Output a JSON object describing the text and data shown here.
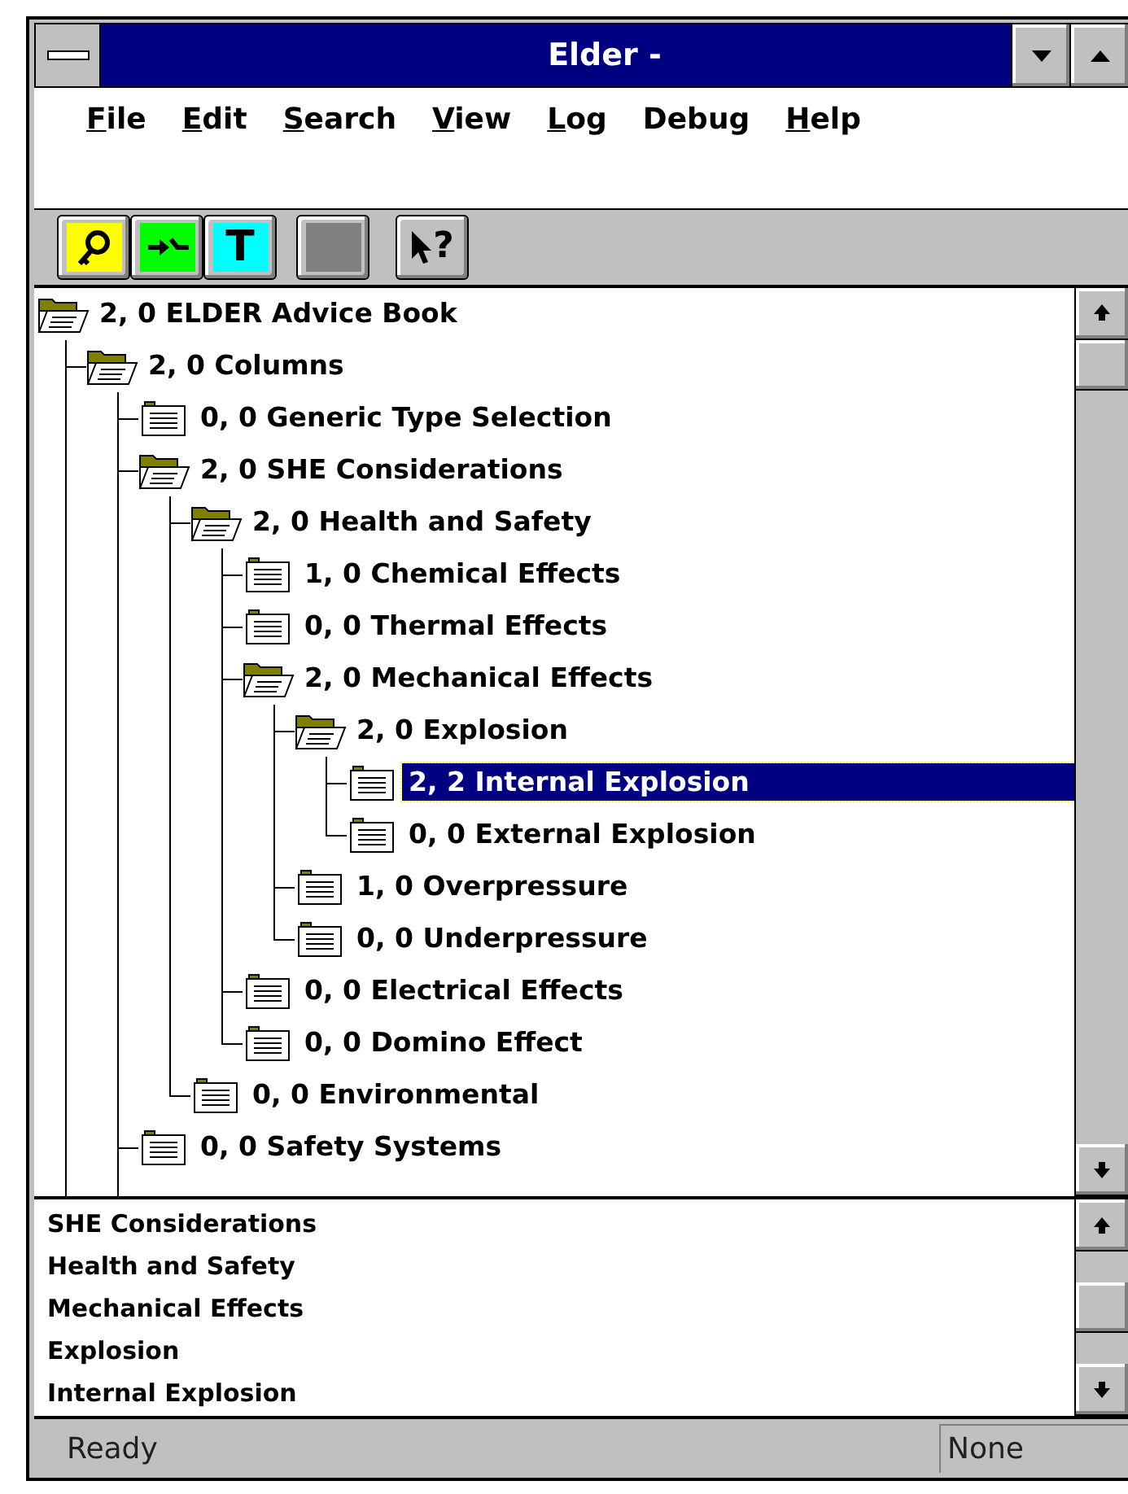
{
  "window": {
    "title": "Elder -"
  },
  "menu": [
    {
      "mnemonic": "F",
      "rest": "ile"
    },
    {
      "mnemonic": "E",
      "rest": "dit"
    },
    {
      "mnemonic": "S",
      "rest": "earch"
    },
    {
      "mnemonic": "V",
      "rest": "iew"
    },
    {
      "mnemonic": "L",
      "rest": "og"
    },
    {
      "rest": "Debug"
    },
    {
      "mnemonic": "H",
      "rest": "elp"
    }
  ],
  "toolbar": [
    {
      "kind": "key",
      "color": "#ffff00"
    },
    {
      "kind": "plug",
      "color": "#00ff00"
    },
    {
      "kind": "text",
      "color": "#00ffff",
      "label": "T"
    },
    {
      "kind": "blank",
      "color": "#808080"
    },
    {
      "kind": "help",
      "color": "#c0c0c0",
      "label": "?"
    }
  ],
  "tree": [
    {
      "label": "2, 0 ELDER Advice Book",
      "kind": "folder",
      "selected": false,
      "children": [
        {
          "label": "2, 0 Columns",
          "kind": "folder",
          "selected": false,
          "has_more": true,
          "children": [
            {
              "label": "0, 0 Generic Type Selection",
              "kind": "document",
              "selected": false
            },
            {
              "label": "2, 0 SHE Considerations",
              "kind": "folder",
              "selected": false,
              "children": [
                {
                  "label": "2, 0 Health and Safety",
                  "kind": "folder",
                  "selected": false,
                  "children": [
                    {
                      "label": "1, 0 Chemical Effects",
                      "kind": "document",
                      "selected": false
                    },
                    {
                      "label": "0, 0 Thermal Effects",
                      "kind": "document",
                      "selected": false
                    },
                    {
                      "label": "2, 0 Mechanical Effects",
                      "kind": "folder",
                      "selected": false,
                      "children": [
                        {
                          "label": "2, 0 Explosion",
                          "kind": "folder",
                          "selected": false,
                          "children": [
                            {
                              "label": "2, 2 Internal Explosion",
                              "kind": "document",
                              "selected": true
                            },
                            {
                              "label": "0, 0 External Explosion",
                              "kind": "document",
                              "selected": false
                            }
                          ]
                        },
                        {
                          "label": "1, 0 Overpressure",
                          "kind": "document",
                          "selected": false
                        },
                        {
                          "label": "0, 0 Underpressure",
                          "kind": "document",
                          "selected": false
                        }
                      ]
                    },
                    {
                      "label": "0, 0 Electrical Effects",
                      "kind": "document",
                      "selected": false
                    },
                    {
                      "label": "0, 0 Domino Effect",
                      "kind": "document",
                      "selected": false
                    }
                  ]
                },
                {
                  "label": "0, 0 Environmental",
                  "kind": "document",
                  "selected": false
                }
              ]
            },
            {
              "label": "0, 0 Safety Systems",
              "kind": "document",
              "selected": false,
              "has_more": true
            }
          ]
        }
      ]
    }
  ],
  "path_list": [
    "SHE Considerations",
    "Health and Safety",
    "Mechanical Effects",
    "Explosion",
    "Internal Explosion"
  ],
  "status_bar": {
    "message": "Ready",
    "mode": "None"
  }
}
